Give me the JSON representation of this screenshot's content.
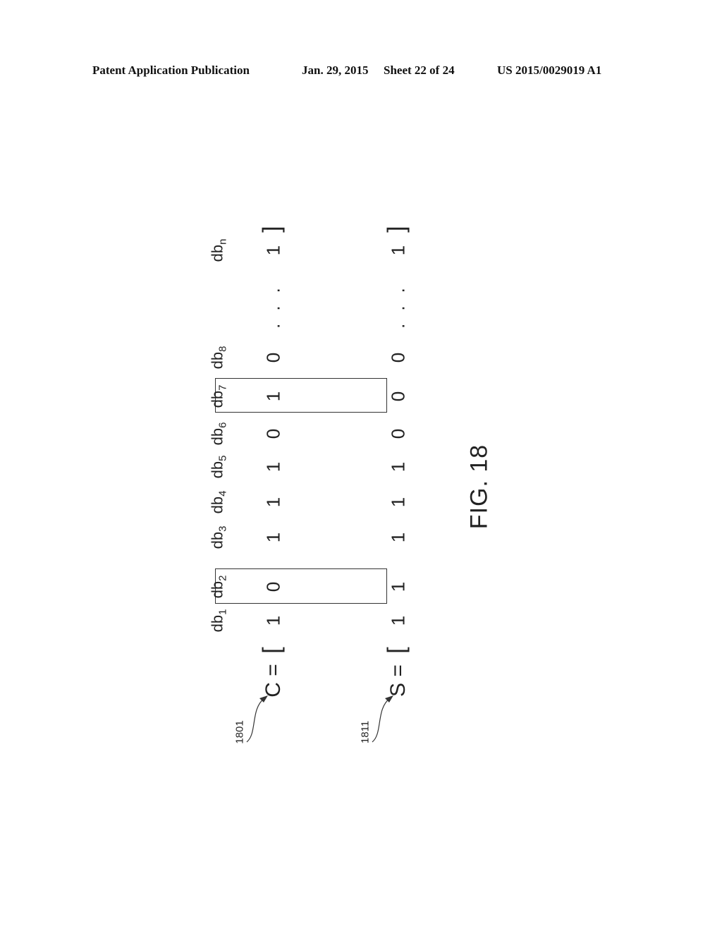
{
  "header": {
    "publication": "Patent Application Publication",
    "date": "Jan. 29, 2015",
    "sheet": "Sheet 22 of 24",
    "number": "US 2015/0029019 A1"
  },
  "figure": {
    "caption": "FIG. 18",
    "columns": [
      {
        "base": "db",
        "sub": "1"
      },
      {
        "base": "db",
        "sub": "2"
      },
      {
        "base": "db",
        "sub": "3"
      },
      {
        "base": "db",
        "sub": "4"
      },
      {
        "base": "db",
        "sub": "5"
      },
      {
        "base": "db",
        "sub": "6"
      },
      {
        "base": "db",
        "sub": "7"
      },
      {
        "base": "db",
        "sub": "8"
      },
      {
        "base": "",
        "sub": ""
      },
      {
        "base": "db",
        "sub": "n"
      }
    ],
    "rows": [
      {
        "ref": "1801",
        "name": "C",
        "eq": "=",
        "open": "[",
        "close": "]",
        "values": [
          "1",
          "0",
          "1",
          "1",
          "1",
          "0",
          "1",
          "0",
          "...",
          "1"
        ]
      },
      {
        "ref": "1811",
        "name": "S",
        "eq": "=",
        "open": "[",
        "close": "]",
        "values": [
          "1",
          "1",
          "1",
          "1",
          "1",
          "0",
          "0",
          "0",
          "...",
          "1"
        ]
      }
    ],
    "highlighted_columns": [
      "db2",
      "db7"
    ]
  }
}
